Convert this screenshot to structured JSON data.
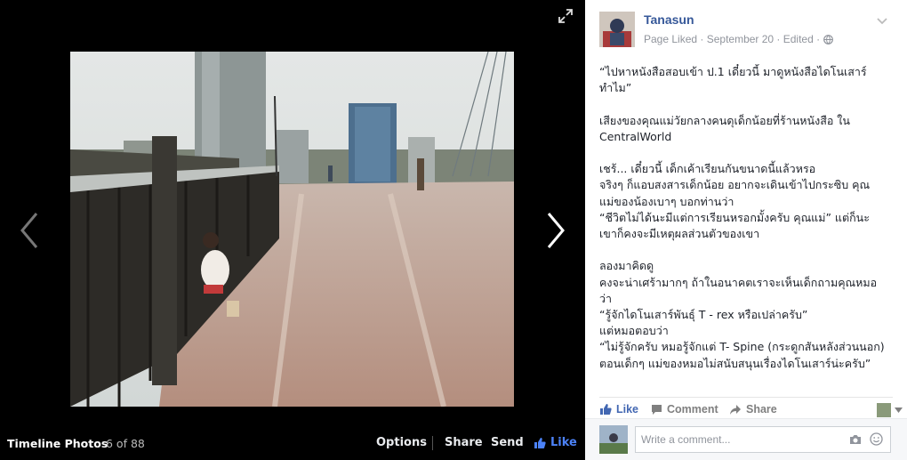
{
  "viewer": {
    "album_name": "Timeline Photos",
    "counter": "6 of 88",
    "actions": {
      "options": "Options",
      "share": "Share",
      "send": "Send",
      "like": "Like"
    },
    "icons": {
      "prev": "chevron-left-icon",
      "next": "chevron-right-icon",
      "fullscreen": "expand-icon",
      "like": "thumbs-up-icon"
    }
  },
  "post": {
    "author": "Tanasun",
    "meta": "Page Liked · September 20 · Edited ·",
    "privacy_icon": "globe-icon",
    "caption": "“ไปหาหนังสือสอบเข้า ป.1 เดี๋ยวนี้ มาดูหนังสือไดโนเสาร์\nทำไม”\n\nเสียงของคุณแม่วัยกลางคนดุเด็กน้อยที่ร้านหนังสือ ใน\nCentralWorld\n\nเชร้... เดี๋ยวนี้ เด็กเค้าเรียนกันขนาดนี้แล้วหรอ\nจริงๆ ก็แอบสงสารเด็กน้อย อยากจะเดินเข้าไปกระซิบ คุณ\nแม่ของน้องเบาๆ บอกท่านว่า\n“ชีวิตไม่ได้นะมีแต่การเรียนหรอกมั้งครับ คุณแม่” แต่ก็นะ\nเขาก็คงจะมีเหตุผลส่วนตัวของเขา\n\nลองมาคิดดู\nคงจะน่าเศร้ามากๆ ถ้าในอนาคตเราจะเห็นเด็กถามคุณหมอ\nว่า\n“รู้จักไดโนเสาร์พันธุ์ T - rex หรือเปล่าครับ”\nแต่หมอตอบว่า\n“ไม่รู้จักครับ หมอรู้จักแต่ T- Spine (กระดูกสันหลังส่วนนอก)\nตอนเด็กๆ แม่ของหมอไม่สนับสนุนเรื่องไดโนเสาร์น่ะครับ”"
  },
  "actions": {
    "like": "Like",
    "comment": "Comment",
    "share": "Share"
  },
  "comment_box": {
    "placeholder": "Write a comment..."
  },
  "colors": {
    "link_blue": "#365899",
    "like_blue": "#4267b2",
    "viewer_like": "#4c82f7"
  }
}
